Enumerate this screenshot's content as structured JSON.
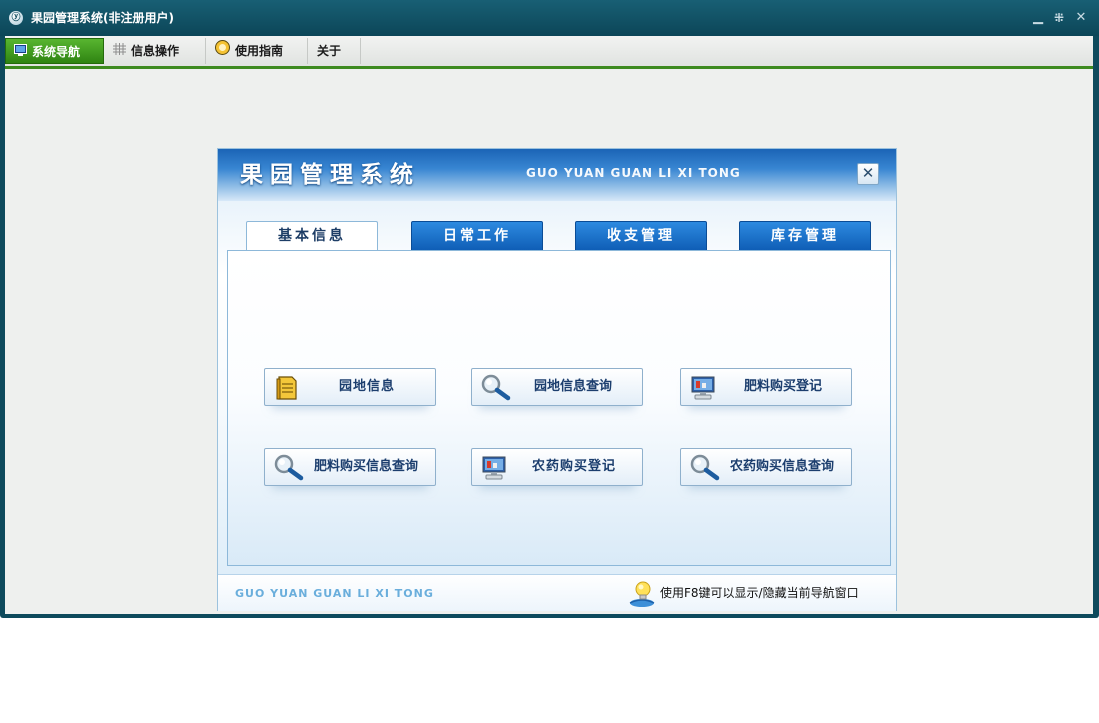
{
  "window": {
    "title": "果园管理系统(非注册用户)",
    "icon_glyph": "ⓨ"
  },
  "menubar": {
    "tabs": [
      {
        "label": "系统导航",
        "icon": "monitor-icon",
        "active": true
      },
      {
        "label": "信息操作",
        "icon": "grid-icon",
        "active": false
      },
      {
        "label": "使用指南",
        "icon": "guide-icon",
        "active": false
      },
      {
        "label": "关于",
        "icon": "",
        "active": false
      }
    ]
  },
  "nav": {
    "title": "果园管理系统",
    "title_en": "GUO YUAN GUAN LI XI TONG",
    "close_glyph": "✕",
    "tabs": [
      {
        "label": "基本信息",
        "active": true
      },
      {
        "label": "日常工作",
        "active": false
      },
      {
        "label": "收支管理",
        "active": false
      },
      {
        "label": "库存管理",
        "active": false
      }
    ],
    "buttons": [
      {
        "label": "园地信息",
        "icon": "document-icon"
      },
      {
        "label": "园地信息查询",
        "icon": "magnifier-icon"
      },
      {
        "label": "肥料购买登记",
        "icon": "computer-icon"
      },
      {
        "label": "肥料购买信息查询",
        "icon": "magnifier-icon"
      },
      {
        "label": "农药购买登记",
        "icon": "computer-icon"
      },
      {
        "label": "农药购买信息查询",
        "icon": "magnifier-icon"
      }
    ],
    "footer": {
      "brand_en": "GUO YUAN GUAN LI XI TONG",
      "tip": "使用F8键可以显示/隐藏当前导航窗口"
    }
  },
  "colors": {
    "title_bar": "#0e4a5c",
    "menu_active": "#3d9a1f",
    "nav_header": "#2a7ad0",
    "button_text": "#1c3e6e"
  }
}
